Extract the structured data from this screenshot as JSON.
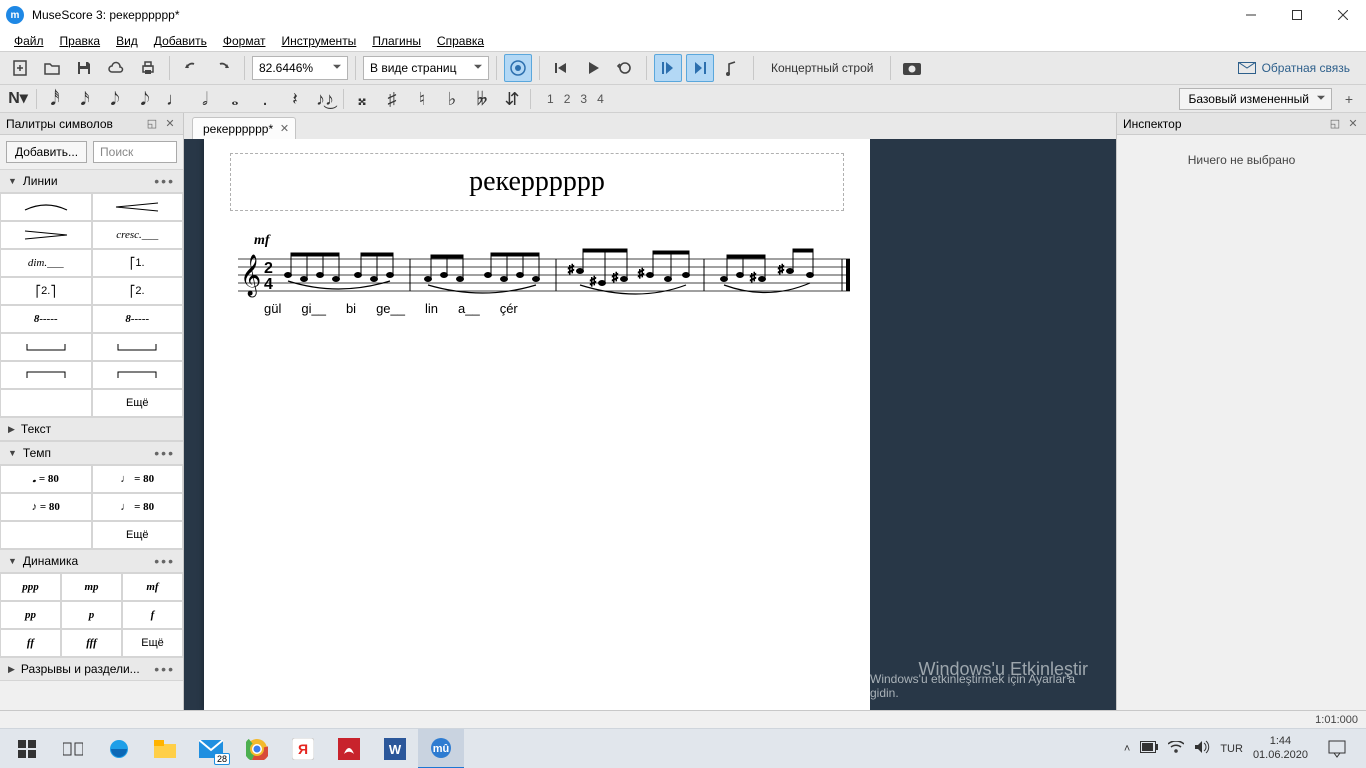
{
  "window": {
    "app_title": "MuseScore 3: рекерррррр*"
  },
  "menu": {
    "items": [
      "Файл",
      "Правка",
      "Вид",
      "Добавить",
      "Формат",
      "Инструменты",
      "Плагины",
      "Справка"
    ]
  },
  "toolbar1": {
    "zoom": "82.6446%",
    "view_mode": "В виде страниц",
    "concert_pitch": "Концертный строй",
    "feedback": "Обратная связь"
  },
  "toolbar2": {
    "voice_numbers": [
      "1",
      "2",
      "3",
      "4"
    ],
    "workspace": "Базовый измененный"
  },
  "palettes": {
    "panel_title": "Палитры символов",
    "add_btn": "Добавить...",
    "search_placeholder": "Поиск",
    "sections": {
      "lines": {
        "title": "Линии",
        "more": "Ещё",
        "cells": [
          "",
          "",
          "",
          "cresc.___",
          "dim.___",
          "1.",
          "2.",
          "2.",
          "8-----",
          "8-----",
          "",
          "",
          "",
          ""
        ]
      },
      "text": {
        "title": "Текст"
      },
      "tempo": {
        "title": "Темп",
        "more": "Ещё",
        "cells": [
          "𝅗 = 80",
          "♩ = 80",
          "♪ = 80",
          "♩ = 80"
        ]
      },
      "dynamics": {
        "title": "Динамика",
        "more": "Ещё",
        "cells": [
          "ppp",
          "mp",
          "mf",
          "pp",
          "p",
          "f",
          "ff",
          "fff"
        ]
      },
      "breaks": {
        "title": "Разрывы и раздели..."
      }
    }
  },
  "document": {
    "tab_name": "рекерррррр*",
    "score_title": "рекерррррр",
    "dynamic": "mf",
    "lyrics": [
      "gül",
      "gi__",
      "bi",
      "ge__",
      "lin",
      "a__",
      "çér"
    ]
  },
  "inspector": {
    "panel_title": "Инспектор",
    "empty_text": "Ничего не выбрано"
  },
  "canvas_hint": {
    "line1": "Windows'u Etkinleştir",
    "line2": "Windows'u etkinleştirmek için Ayarlar'a gidin."
  },
  "statusbar": {
    "time": "1:01:000"
  },
  "taskbar": {
    "mail_badge": "28",
    "lang": "TUR",
    "clock_time": "1:44",
    "clock_date": "01.06.2020"
  }
}
